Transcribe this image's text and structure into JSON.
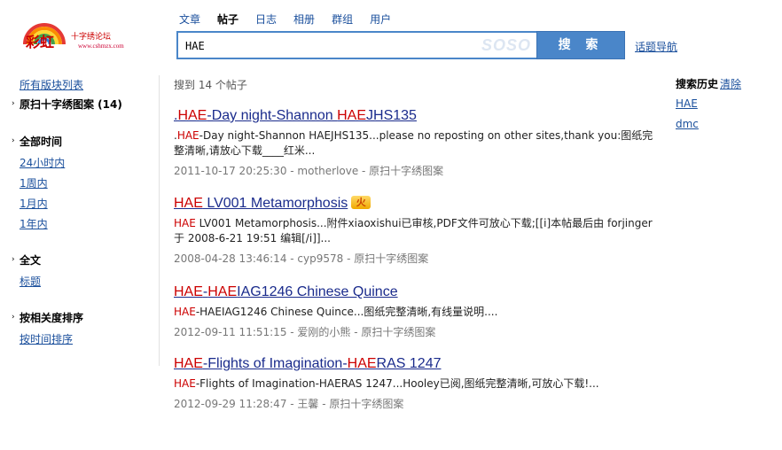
{
  "logo": {
    "brand": "彩虹",
    "tagline": "十字绣论坛",
    "url": "www.cshmzx.com"
  },
  "nav": {
    "tabs": [
      {
        "label": "文章",
        "active": false
      },
      {
        "label": "帖子",
        "active": true
      },
      {
        "label": "日志",
        "active": false
      },
      {
        "label": "相册",
        "active": false
      },
      {
        "label": "群组",
        "active": false
      },
      {
        "label": "用户",
        "active": false
      }
    ]
  },
  "search": {
    "value": "HAE",
    "watermark": "SOSO",
    "button_label": "搜 索",
    "topic_nav_label": "话题导航"
  },
  "sidebar": {
    "all_forums": "所有版块列表",
    "current_forum": "原扫十字绣图案 (14)",
    "time_heading": "全部时间",
    "time_options": [
      "24小时内",
      "1周内",
      "1月内",
      "1年内"
    ],
    "scope_heading": "全文",
    "scope_options": [
      "标题"
    ],
    "sort_heading": "按相关度排序",
    "sort_options": [
      "按时间排序"
    ]
  },
  "results": {
    "summary": "搜到 14 个帖子",
    "items": [
      {
        "title_parts": [
          {
            "text": ".",
            "hl": false
          },
          {
            "text": "HAE",
            "hl": true
          },
          {
            "text": "-Day night-Shannon ",
            "hl": false
          },
          {
            "text": "HAE",
            "hl": true
          },
          {
            "text": "JHS135",
            "hl": false
          }
        ],
        "hot": false,
        "snippet_hl": "HAE",
        "snippet_prefix": ".",
        "snippet_rest": "-Day night-Shannon HAEJHS135...please no reposting on other sites,thank you:图纸完整清晰,请放心下载____红米...",
        "meta": "2011-10-17 20:25:30 - motherlove - 原扫十字绣图案"
      },
      {
        "title_parts": [
          {
            "text": "HAE",
            "hl": true
          },
          {
            "text": " LV001 Metamorphosis",
            "hl": false
          }
        ],
        "hot": true,
        "hot_label": "火",
        "snippet_hl": "HAE",
        "snippet_prefix": "",
        "snippet_rest": " LV001 Metamorphosis...附件xiaoxishui已审核,PDF文件可放心下载;[[i]本帖最后由 forjinger 于 2008-6-21 19:51 编辑[/i]]...",
        "meta": "2008-04-28 13:46:14 - cyp9578 - 原扫十字绣图案"
      },
      {
        "title_parts": [
          {
            "text": "HAE",
            "hl": true
          },
          {
            "text": "-",
            "hl": false
          },
          {
            "text": "HAE",
            "hl": true
          },
          {
            "text": "IAG1246 Chinese Quince",
            "hl": false
          }
        ],
        "hot": false,
        "snippet_hl": "HAE",
        "snippet_prefix": "",
        "snippet_rest": "-HAEIAG1246 Chinese Quince...图纸完整清晰,有线量说明....",
        "meta": "2012-09-11 11:51:15 - 爱刚的小熊 - 原扫十字绣图案"
      },
      {
        "title_parts": [
          {
            "text": "HAE",
            "hl": true
          },
          {
            "text": "-Flights of Imagination-",
            "hl": false
          },
          {
            "text": "HAE",
            "hl": true
          },
          {
            "text": "RAS 1247",
            "hl": false
          }
        ],
        "hot": false,
        "snippet_hl": "HAE",
        "snippet_prefix": "",
        "snippet_rest": "-Flights of Imagination-HAERAS 1247...Hooley已阅,图纸完整清晰,可放心下载!...",
        "meta": "2012-09-29 11:28:47 - 王馨 - 原扫十字绣图案"
      }
    ]
  },
  "history": {
    "title": "搜索历史",
    "clear_label": "清除",
    "items": [
      "HAE",
      "dmc"
    ]
  }
}
